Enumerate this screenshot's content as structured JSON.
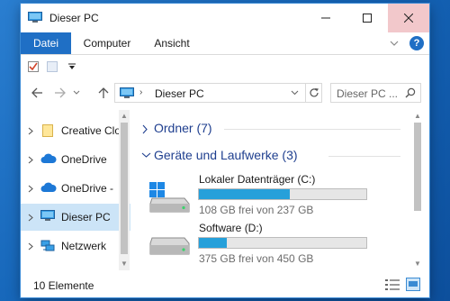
{
  "window": {
    "title": "Dieser PC"
  },
  "ribbon": {
    "tabs": [
      "Datei",
      "Computer",
      "Ansicht"
    ],
    "help_label": "?"
  },
  "address": {
    "path": "Dieser PC",
    "search_placeholder": "Dieser PC ..."
  },
  "nav": {
    "items": [
      {
        "label": "Creative Clo",
        "icon": "folder-icon"
      },
      {
        "label": "OneDrive",
        "icon": "cloud-icon"
      },
      {
        "label": "OneDrive -",
        "icon": "cloud-icon"
      },
      {
        "label": "Dieser PC",
        "icon": "computer-icon",
        "selected": true
      },
      {
        "label": "Netzwerk",
        "icon": "network-icon"
      }
    ]
  },
  "groups": {
    "folders": {
      "label": "Ordner (7)",
      "expanded": false
    },
    "devices": {
      "label": "Geräte und Laufwerke (3)",
      "expanded": true
    }
  },
  "drives": [
    {
      "name": "Lokaler Datenträger (C:)",
      "free_text": "108 GB frei von 237 GB",
      "used_fraction": 0.544,
      "icon": "windows-drive-icon"
    },
    {
      "name": "Software (D:)",
      "free_text": "375 GB frei von 450 GB",
      "used_fraction": 0.167,
      "icon": "hard-drive-icon"
    }
  ],
  "status": {
    "item_count": "10 Elemente"
  },
  "colors": {
    "accent": "#1f6fc5",
    "bar_fill": "#26a0da",
    "selection": "#cce4f7",
    "group_text": "#1f3f8f"
  }
}
